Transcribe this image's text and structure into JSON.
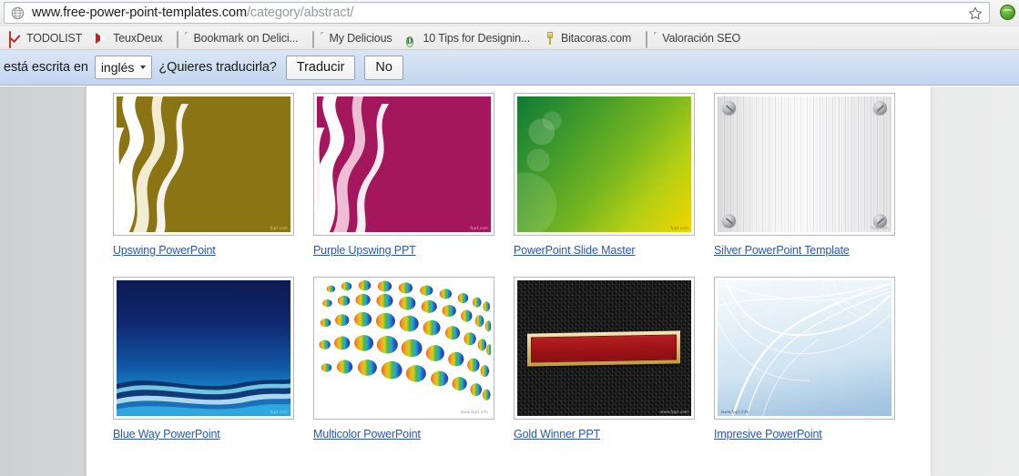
{
  "browser": {
    "omnibox": {
      "url_main": "www.free-power-point-templates.com",
      "url_path": "/category/abstract/",
      "globe_icon": "globe-icon",
      "star_icon": "star-bookmark-icon"
    },
    "extension_icon": "green-extension-icon",
    "bookmarks": [
      {
        "label": "TODOLIST",
        "icon": "checkbox-icon"
      },
      {
        "label": "TeuxDeux",
        "icon": "red-arrow-icon"
      },
      {
        "label": "Bookmark on Delici...",
        "icon": "page-icon"
      },
      {
        "label": "My Delicious",
        "icon": "page-icon"
      },
      {
        "label": "10 Tips for Designin...",
        "icon": "letter-d-circle-icon"
      },
      {
        "label": "Bitacoras.com",
        "icon": "pin-icon"
      },
      {
        "label": "Valoración SEO",
        "icon": "page-icon"
      }
    ]
  },
  "translate_bar": {
    "message_prefix": "está escrita en",
    "language_value": "inglés",
    "question": "¿Quieres traducirla?",
    "translate_button": "Traducir",
    "decline_button": "No",
    "dropdown_icon": "chevron-down-icon"
  },
  "gallery": {
    "items": [
      {
        "title": "Upswing PowerPoint",
        "style": "t-gold",
        "art": "ribbons",
        "watermark": "fppt.com",
        "wm_color": "#e8dca8"
      },
      {
        "title": "Purple Upswing PPT",
        "style": "t-purple",
        "art": "ribbons",
        "watermark": "fppt.com",
        "wm_color": "#f3c9dd"
      },
      {
        "title": "PowerPoint Slide Master",
        "style": "t-green",
        "art": "none",
        "watermark": "fppt.com",
        "wm_color": "#6d6a12"
      },
      {
        "title": "Silver PowerPoint Template",
        "style": "t-silver",
        "art": "screws",
        "watermark": "fppt.com",
        "wm_color": "#9b9b9e"
      },
      {
        "title": "Blue Way PowerPoint",
        "style": "t-blue",
        "art": "waves",
        "watermark": "fppt.com",
        "wm_color": "#bcd9ee"
      },
      {
        "title": "Multicolor PowerPoint",
        "style": "t-multi",
        "art": "dots",
        "watermark": "www.fppt.info",
        "wm_color": "#8a8a8a"
      },
      {
        "title": "Gold Winner PPT",
        "style": "t-carbon",
        "art": "banner",
        "watermark": "www.fppt.com",
        "wm_color": "#c9c9c9"
      },
      {
        "title": "Impresive PowerPoint",
        "style": "t-ice",
        "art": "swoops",
        "watermark": "www.fppt.info",
        "wm_color": "#2b4a6b"
      }
    ]
  },
  "colors": {
    "link": "#2b55b0",
    "translate_bar_bg": "#cfdef2",
    "gold": "#8a7413",
    "purple": "#a5175d",
    "green": "#3f9a2b",
    "blue": "#1157a5",
    "red_banner": "#b51e22"
  }
}
